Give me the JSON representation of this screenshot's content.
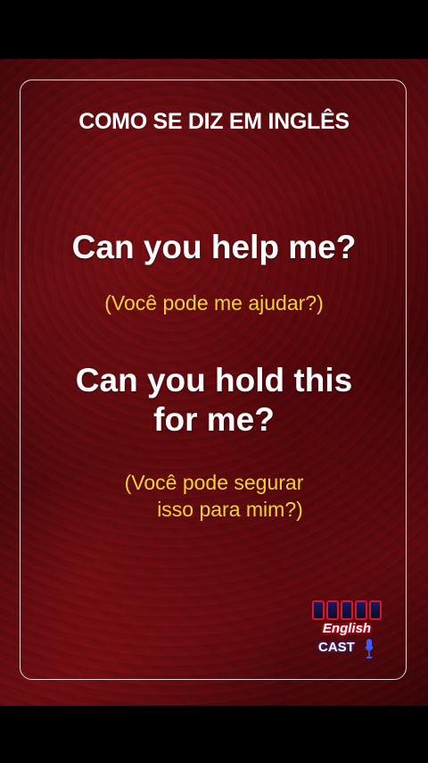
{
  "card": {
    "heading": "COMO SE DIZ EM INGLÊS",
    "phrases": [
      {
        "english_lines": [
          "Can you help me?"
        ],
        "translation_lines": [
          "(Você pode me ajudar?)"
        ]
      },
      {
        "english_lines": [
          "Can you hold this",
          "for me?"
        ],
        "translation_lines": [
          "(Você pode segurar",
          "isso para mim?)"
        ]
      }
    ]
  },
  "logo": {
    "line1": "English",
    "line2": "CAST",
    "icon": "microphone-icon"
  },
  "colors": {
    "translation": "#f5d23a",
    "text": "#ffffff",
    "background": "#5c0b10"
  }
}
